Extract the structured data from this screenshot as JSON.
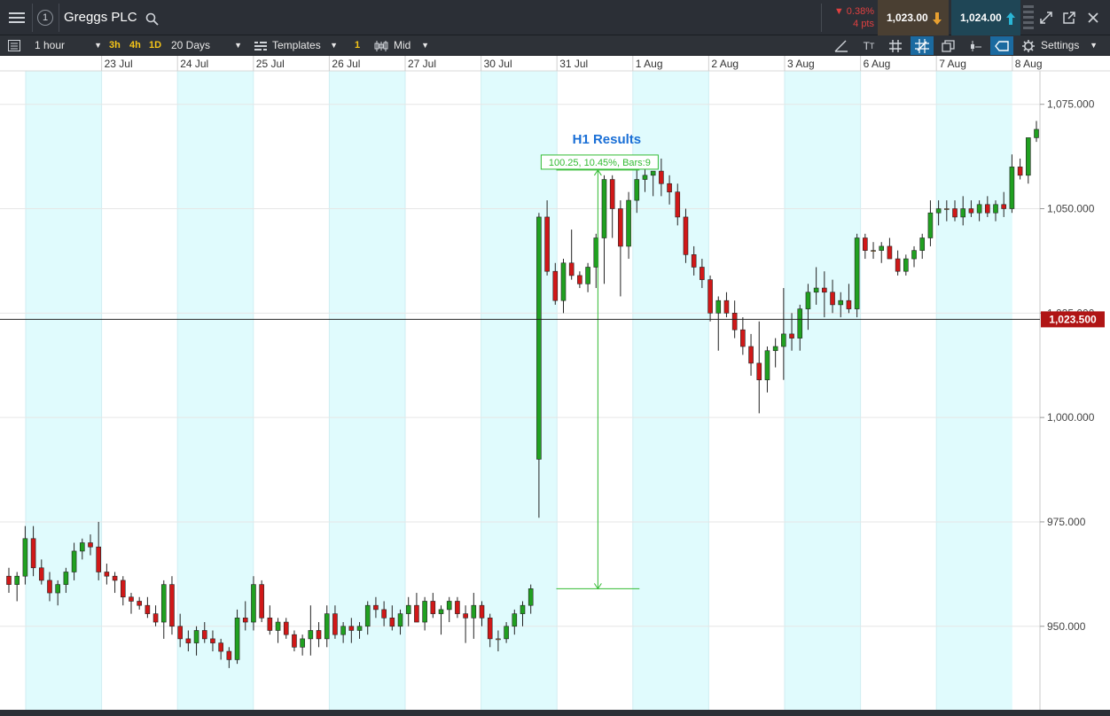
{
  "header": {
    "title": "Greggs PLC",
    "widget_number": "1",
    "change_pct": "▼ 0.38%",
    "change_pts": "4 pts",
    "sell_price": "1,023.00",
    "buy_price": "1,024.00"
  },
  "toolbar": {
    "interval": "1 hour",
    "quick_intervals": [
      "3h",
      "4h",
      "1D"
    ],
    "range": "20 Days",
    "templates": "Templates",
    "badge": "1",
    "price_type": "Mid",
    "settings": "Settings"
  },
  "colors": {
    "up": "#20a020",
    "down": "#d01818",
    "neutral": "#e8a040",
    "band": "#e0fbfd",
    "measure": "#33bb33",
    "annotation": "#1a6fd6",
    "price_tag": "#b01515"
  },
  "chart_data": {
    "type": "candlestick",
    "title": "",
    "x_labels": [
      "23 Jul",
      "24 Jul",
      "25 Jul",
      "26 Jul",
      "27 Jul",
      "30 Jul",
      "31 Jul",
      "1 Aug",
      "2 Aug",
      "3 Aug",
      "6 Aug",
      "7 Aug",
      "8 Aug"
    ],
    "y_ticks": [
      950,
      975,
      1000,
      1025,
      1050,
      1075
    ],
    "y_tick_labels": [
      "950.000",
      "975.000",
      "1,000.000",
      "1,025.000",
      "1,050.000",
      "1,075.000"
    ],
    "ylim": [
      930,
      1083
    ],
    "current_price": 1023.5,
    "current_price_label": "1,023.500",
    "annotation": "H1 Results",
    "measure_label": "100.25, 10.45%, Bars:9",
    "measure": {
      "start_bar": 68,
      "end_bar": 77,
      "low": 959,
      "high": 1059.25
    },
    "candles": [
      [
        962,
        964,
        958,
        960
      ],
      [
        960,
        963,
        956,
        962
      ],
      [
        962,
        974,
        960,
        971
      ],
      [
        971,
        974,
        962,
        964
      ],
      [
        964,
        966,
        960,
        961
      ],
      [
        961,
        963,
        956,
        958
      ],
      [
        958,
        961,
        955,
        960
      ],
      [
        960,
        964,
        958,
        963
      ],
      [
        963,
        970,
        961,
        968
      ],
      [
        968,
        971,
        966,
        970
      ],
      [
        970,
        972,
        967,
        969
      ],
      [
        969,
        975,
        961,
        963
      ],
      [
        963,
        965,
        960,
        962
      ],
      [
        962,
        963,
        958,
        961
      ],
      [
        961,
        962,
        955,
        957
      ],
      [
        957,
        958,
        953,
        956
      ],
      [
        956,
        957,
        954,
        955
      ],
      [
        955,
        957,
        952,
        953
      ],
      [
        953,
        955,
        950,
        951
      ],
      [
        951,
        961,
        947,
        960
      ],
      [
        960,
        962,
        948,
        950
      ],
      [
        950,
        953,
        945,
        947
      ],
      [
        947,
        949,
        944,
        946
      ],
      [
        946,
        950,
        943,
        949
      ],
      [
        949,
        951,
        946,
        947
      ],
      [
        947,
        949,
        944,
        946
      ],
      [
        946,
        947,
        942,
        944
      ],
      [
        944,
        945,
        940,
        942
      ],
      [
        942,
        954,
        941,
        952
      ],
      [
        952,
        956,
        949,
        951
      ],
      [
        951,
        962,
        949,
        960
      ],
      [
        960,
        961,
        951,
        952
      ],
      [
        952,
        955,
        948,
        949
      ],
      [
        949,
        952,
        946,
        951
      ],
      [
        951,
        952,
        947,
        948
      ],
      [
        948,
        949,
        944,
        945
      ],
      [
        945,
        948,
        943,
        947
      ],
      [
        947,
        955,
        943,
        949
      ],
      [
        949,
        951,
        945,
        947
      ],
      [
        947,
        955,
        945,
        953
      ],
      [
        953,
        955,
        947,
        948
      ],
      [
        948,
        951,
        946,
        950
      ],
      [
        950,
        952,
        946,
        949
      ],
      [
        949,
        951,
        947,
        950
      ],
      [
        950,
        956,
        948,
        955
      ],
      [
        955,
        957,
        952,
        954
      ],
      [
        954,
        956,
        950,
        952
      ],
      [
        952,
        955,
        949,
        950
      ],
      [
        950,
        954,
        948,
        953
      ],
      [
        953,
        957,
        950,
        955
      ],
      [
        955,
        958,
        951,
        951
      ],
      [
        951,
        957,
        949,
        956
      ],
      [
        956,
        958,
        952,
        953
      ],
      [
        953,
        955,
        948,
        954
      ],
      [
        954,
        957,
        951,
        956
      ],
      [
        956,
        957,
        952,
        953
      ],
      [
        953,
        955,
        946,
        952
      ],
      [
        952,
        958,
        947,
        955
      ],
      [
        955,
        956,
        950,
        952
      ],
      [
        952,
        953,
        945,
        947
      ],
      [
        947,
        949,
        944,
        947
      ],
      [
        947,
        951,
        946,
        950
      ],
      [
        950,
        954,
        948,
        953
      ],
      [
        953,
        956,
        950,
        955
      ],
      [
        955,
        960,
        953,
        959
      ],
      [
        990,
        1049,
        976,
        1048
      ],
      [
        1048,
        1052,
        1034,
        1035
      ],
      [
        1035,
        1037,
        1027,
        1028
      ],
      [
        1028,
        1038,
        1025,
        1037
      ],
      [
        1037,
        1045,
        1033,
        1034
      ],
      [
        1034,
        1035,
        1031,
        1032
      ],
      [
        1032,
        1037,
        1030,
        1036
      ],
      [
        1036,
        1044,
        1031,
        1043
      ],
      [
        1043,
        1058,
        1032,
        1057
      ],
      [
        1057,
        1058,
        1043,
        1050
      ],
      [
        1050,
        1052,
        1029,
        1041
      ],
      [
        1041,
        1054,
        1038,
        1052
      ],
      [
        1052,
        1061,
        1049,
        1057
      ],
      [
        1057,
        1060,
        1054,
        1058
      ],
      [
        1058,
        1059,
        1053,
        1059
      ],
      [
        1059,
        1062,
        1053,
        1056
      ],
      [
        1056,
        1058,
        1051,
        1054
      ],
      [
        1054,
        1056,
        1046,
        1048
      ],
      [
        1048,
        1050,
        1037,
        1039
      ],
      [
        1039,
        1041,
        1034,
        1036
      ],
      [
        1036,
        1038,
        1031,
        1033
      ],
      [
        1033,
        1034,
        1023,
        1025
      ],
      [
        1025,
        1029,
        1016,
        1028
      ],
      [
        1028,
        1030,
        1024,
        1025
      ],
      [
        1025,
        1028,
        1019,
        1021
      ],
      [
        1021,
        1024,
        1015,
        1017
      ],
      [
        1017,
        1020,
        1010,
        1013
      ],
      [
        1013,
        1023,
        1001,
        1009
      ],
      [
        1009,
        1017,
        1006,
        1016
      ],
      [
        1016,
        1019,
        1012,
        1017
      ],
      [
        1017,
        1031,
        1009,
        1020
      ],
      [
        1020,
        1025,
        1016,
        1019
      ],
      [
        1019,
        1027,
        1016,
        1026
      ],
      [
        1026,
        1032,
        1021,
        1030
      ],
      [
        1030,
        1036,
        1027,
        1031
      ],
      [
        1031,
        1035,
        1024,
        1030
      ],
      [
        1030,
        1033,
        1025,
        1027
      ],
      [
        1027,
        1030,
        1024,
        1028
      ],
      [
        1028,
        1032,
        1025,
        1026
      ],
      [
        1026,
        1044,
        1024,
        1043
      ],
      [
        1043,
        1044,
        1038,
        1040
      ],
      [
        1040,
        1042,
        1038,
        1040
      ],
      [
        1040,
        1042,
        1037,
        1041
      ],
      [
        1041,
        1043,
        1038,
        1038
      ],
      [
        1038,
        1040,
        1034,
        1035
      ],
      [
        1035,
        1039,
        1034,
        1038
      ],
      [
        1038,
        1041,
        1036,
        1040
      ],
      [
        1040,
        1044,
        1038,
        1043
      ],
      [
        1043,
        1052,
        1041,
        1049
      ],
      [
        1049,
        1052,
        1046,
        1050
      ],
      [
        1050,
        1052,
        1047,
        1050
      ],
      [
        1050,
        1052,
        1047,
        1048
      ],
      [
        1048,
        1053,
        1046,
        1050
      ],
      [
        1050,
        1052,
        1048,
        1049
      ],
      [
        1049,
        1052,
        1047,
        1051
      ],
      [
        1051,
        1053,
        1048,
        1049
      ],
      [
        1049,
        1052,
        1047,
        1051
      ],
      [
        1051,
        1054,
        1048,
        1050
      ],
      [
        1050,
        1063,
        1049,
        1060
      ],
      [
        1060,
        1062,
        1057,
        1058
      ],
      [
        1058,
        1067,
        1056,
        1067
      ],
      [
        1067,
        1071,
        1066,
        1069
      ]
    ]
  }
}
